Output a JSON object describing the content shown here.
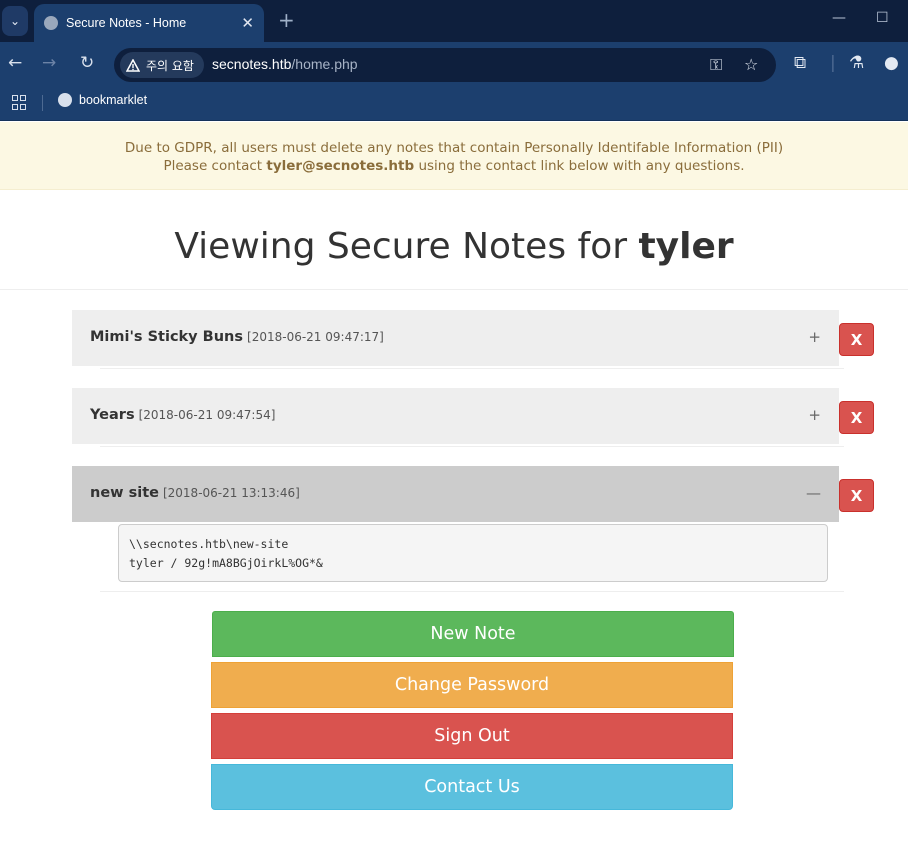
{
  "browser": {
    "tab_title": "Secure Notes - Home",
    "tab_close": "✕",
    "new_tab": "+",
    "security_chip": "주의 요함",
    "url_host": "secnotes.htb",
    "url_path": "/home.php",
    "bookmark": "bookmarklet"
  },
  "banner": {
    "line1": "Due to GDPR, all users must delete any notes that contain Personally Identifable Information (PII)",
    "line2_prefix": "Please contact ",
    "line2_email": "tyler@secnotes.htb",
    "line2_suffix": " using the contact link below with any questions."
  },
  "heading": {
    "prefix": "Viewing Secure Notes for ",
    "user": "tyler"
  },
  "notes": [
    {
      "title": "Mimi's Sticky Buns",
      "date": "[2018-06-21 09:47:17]",
      "toggle": "+",
      "delete": "X"
    },
    {
      "title": "Years",
      "date": "[2018-06-21 09:47:54]",
      "toggle": "+",
      "delete": "X"
    },
    {
      "title": "new site",
      "date": "[2018-06-21 13:13:46]",
      "toggle": "—",
      "delete": "X",
      "body_line1": "\\\\secnotes.htb\\new-site",
      "body_line2": "tyler / 92g!mA8BGjOirkL%OG*&"
    }
  ],
  "buttons": {
    "new_note": "New Note",
    "change_password": "Change Password",
    "sign_out": "Sign Out",
    "contact_us": "Contact Us"
  },
  "colors": {
    "success": "#5cb85c",
    "warning": "#f0ad4e",
    "danger": "#d9534f",
    "info": "#5bc0de",
    "banner_bg": "#fcf8e3",
    "banner_text": "#8a6d3b"
  }
}
